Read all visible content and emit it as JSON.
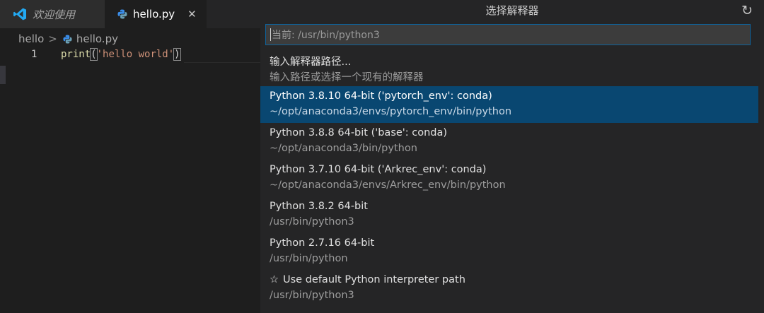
{
  "tabs": [
    {
      "label": "欢迎使用",
      "icon": "vscode-logo-icon"
    },
    {
      "label": "hello.py",
      "icon": "python-icon",
      "close": "✕"
    }
  ],
  "breadcrumb": {
    "folder": "hello",
    "separator": ">",
    "file": "hello.py"
  },
  "editor": {
    "line_number": "1",
    "code": {
      "fn": "print",
      "open": "(",
      "str": "'hello world'",
      "close": ")"
    }
  },
  "picker": {
    "title": "选择解释器",
    "refresh_icon": "↻",
    "input_placeholder": "当前: /usr/bin/python3",
    "items": [
      {
        "label": "输入解释器路径...",
        "detail": "输入路径或选择一个现有的解释器",
        "selected": false
      },
      {
        "label": "Python 3.8.10 64-bit ('pytorch_env': conda)",
        "detail": "~/opt/anaconda3/envs/pytorch_env/bin/python",
        "selected": true
      },
      {
        "label": "Python 3.8.8 64-bit ('base': conda)",
        "detail": "~/opt/anaconda3/bin/python",
        "selected": false
      },
      {
        "label": "Python 3.7.10 64-bit ('Arkrec_env': conda)",
        "detail": "~/opt/anaconda3/envs/Arkrec_env/bin/python",
        "selected": false
      },
      {
        "label": "Python 3.8.2 64-bit",
        "detail": "/usr/bin/python3",
        "selected": false
      },
      {
        "label": "Python 2.7.16 64-bit",
        "detail": "/usr/bin/python",
        "selected": false
      },
      {
        "label": "Use default Python interpreter path",
        "detail": "/usr/bin/python3",
        "selected": false,
        "star": "☆"
      }
    ]
  },
  "colors": {
    "selection": "#094771",
    "accent": "#0e639c",
    "python_blue": "#3b8eea",
    "vscode_blue": "#23a9f2"
  }
}
